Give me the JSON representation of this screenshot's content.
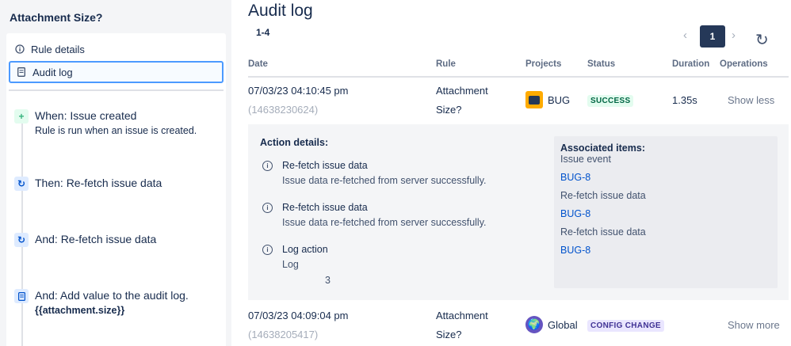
{
  "sidebar": {
    "title": "Attachment Size?",
    "nav": [
      {
        "label": "Rule details",
        "icon": "info-icon"
      },
      {
        "label": "Audit log",
        "icon": "document-icon",
        "selected": true
      }
    ],
    "steps": [
      {
        "title": "When: Issue created",
        "description": "Rule is run when an issue is created.",
        "icon": "plus-icon"
      },
      {
        "title": "Then: Re-fetch issue data",
        "description": "",
        "icon": "refresh-icon"
      },
      {
        "title": "And: Re-fetch issue data",
        "description": "",
        "icon": "refresh-icon"
      },
      {
        "title": "And: Add value to the audit log.",
        "description": "{{attachment.size}}",
        "icon": "document-icon"
      }
    ]
  },
  "main": {
    "title": "Audit log",
    "range": "1-4",
    "pagination": {
      "current": "1"
    },
    "columns": [
      "Date",
      "Rule",
      "Projects",
      "Status",
      "Duration",
      "Operations"
    ],
    "rows": [
      {
        "date": "07/03/23 04:10:45 pm",
        "id": "(14638230624)",
        "rule_line1": "Attachment",
        "rule_line2": "Size?",
        "project": "BUG",
        "status": "SUCCESS",
        "duration": "1.35s",
        "operation": "Show less"
      },
      {
        "date": "07/03/23 04:09:04 pm",
        "id": "(14638205417)",
        "rule_line1": "Attachment",
        "rule_line2": "Size?",
        "project": "Global",
        "status": "CONFIG CHANGE",
        "duration": "",
        "operation": "Show more"
      }
    ],
    "details": {
      "title": "Action details:",
      "actions": [
        {
          "title": "Re-fetch issue data",
          "description": "Issue data re-fetched from server successfully."
        },
        {
          "title": "Re-fetch issue data",
          "description": "Issue data re-fetched from server successfully."
        },
        {
          "title": "Log action",
          "description": "Log"
        }
      ],
      "log_value": "3",
      "associated": {
        "title": "Associated items:",
        "items": [
          {
            "label": "Issue event",
            "link": "BUG-8"
          },
          {
            "label": "Re-fetch issue data",
            "link": "BUG-8"
          },
          {
            "label": "Re-fetch issue data",
            "link": "BUG-8"
          }
        ]
      }
    }
  },
  "colors": {
    "accent": "#0052cc",
    "selected_border": "#4c9aff",
    "success_bg": "#e3fcef",
    "success_text": "#006644",
    "config_bg": "#eae6ff",
    "config_text": "#403294",
    "bug_project": "#ffab00",
    "global_project": "#6554c0"
  }
}
